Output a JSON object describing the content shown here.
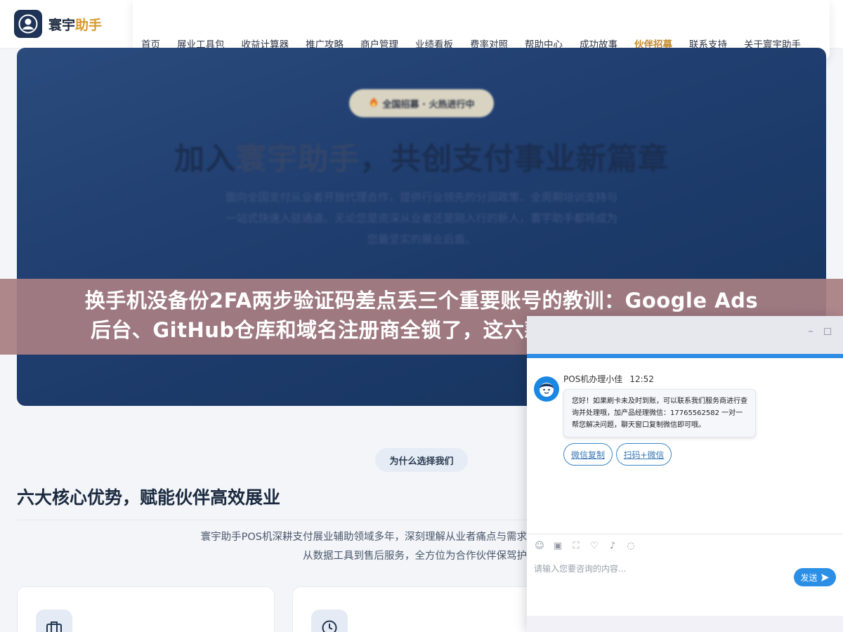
{
  "header": {
    "logo_text": "寰宇",
    "logo_accent": "助手",
    "nav": [
      "首页",
      "展业工具包",
      "收益计算器",
      "推广攻略",
      "商户管理",
      "业绩看板",
      "费率对照",
      "帮助中心",
      "成功故事",
      "伙伴招募",
      "联系支持",
      "关于寰宇助手"
    ],
    "active_index": 9
  },
  "hero": {
    "badge": "全国招募 · 火热进行中",
    "title_pre": "加入",
    "title_highlight": "寰宇助手",
    "title_post": "，共创支付事业新篇章",
    "subtitle_lines": [
      "面向全国支付从业者开放代理合作，提供行业领先的分润政策、全周期培训支持与",
      "一站式快速入驻通道。无论您是资深从业者还是刚入行的新人，寰宇助手都将成为",
      "您最坚实的展业后盾。"
    ]
  },
  "banner": {
    "line1": "换手机没备份2FA两步验证码差点丢三个重要账号的教训：Google Ads",
    "line2": "后台、GitHub仓库和域名注册商全锁了，这六款安全工具关键时刻能救"
  },
  "section": {
    "pill": "为什么选择我们",
    "title": "六大核心优势，赋能伙伴高效展业",
    "desc_lines": [
      "寰宇助手POS机深耕支付展业辅助领域多年，深刻理解从业者痛点与需求",
      "从数据工具到售后服务，全方位为合作伙伴保驾护"
    ],
    "card_icons": [
      "briefcase-icon",
      "clock-icon"
    ]
  },
  "chat": {
    "agent_name": "POS机办理小佳",
    "time": "12:52",
    "message": "您好！如果刷卡未及时到账，可以联系我们服务商进行查询并处理哦，加产品经理微信：17765562582 一对一帮您解决问题，聊天窗口复制微信即可哦。",
    "quick_replies": [
      "微信复制",
      "扫码+微信"
    ],
    "input_placeholder": "请输入您要咨询的内容...",
    "send_label": "发送",
    "colors": {
      "accent": "#2d8ce6"
    }
  },
  "colors": {
    "brand_navy": "#1e3355",
    "brand_gold": "#d99a2b",
    "hero_bg": "#1f3d6e",
    "banner_overlay": "#a87e82"
  }
}
